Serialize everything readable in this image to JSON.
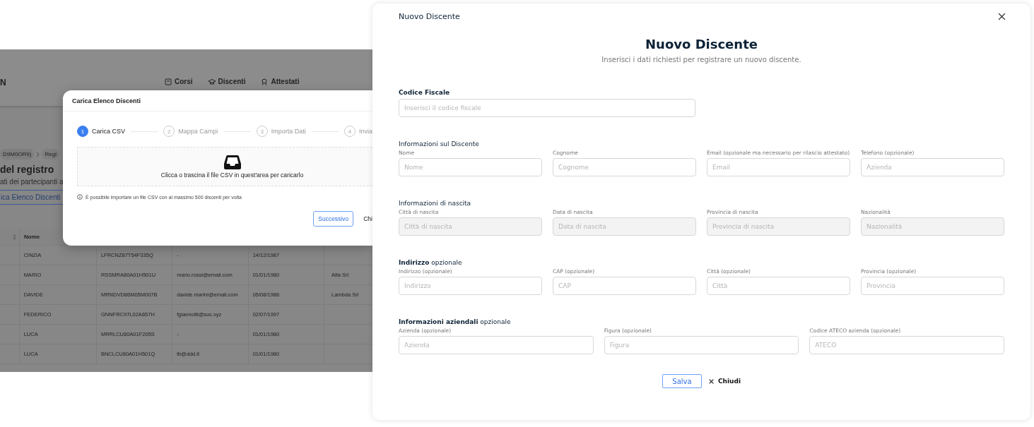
{
  "background_app": {
    "header": {
      "brand": "N",
      "nav": [
        {
          "label": "Corsi"
        },
        {
          "label": "Discenti"
        },
        {
          "label": "Attestati"
        }
      ]
    },
    "breadcrumb": [
      "D9M0OR9)",
      "Regi"
    ],
    "title": "del registro",
    "subtitle": "ati dei partecipanti a",
    "upload_button": "ica Elenco Discenti",
    "table": {
      "columns": [
        "Nome"
      ],
      "rows": [
        {
          "name": "CINZIA",
          "codice": "LFRCNZ87T54F335Q",
          "email": "-",
          "birth": "14/12/1987"
        },
        {
          "name": "MARIO",
          "codice": "RSSMRA80A01H501U",
          "email": "mario.rossi@email.com",
          "birth": "01/01/1980",
          "company": "Alfa Srl"
        },
        {
          "name": "DAVIDE",
          "codice": "MRNDVD86M05M007B",
          "email": "davide.marini@email.com",
          "birth": "05/08/1986",
          "company": "Lambda Srl"
        },
        {
          "name": "FEDERICO",
          "codice": "GNNFRC97L02A657H",
          "email": "fgiannotti@soc.xyz",
          "birth": "02/07/1997"
        },
        {
          "name": "LUCA",
          "codice": "MRRLCU80A01F205S",
          "email": "-",
          "birth": "01/01/1980"
        },
        {
          "name": "LUCA",
          "codice": "BNCLCU80A01H501Q",
          "email": "lb@ddd.it",
          "birth": "01/01/1980"
        }
      ]
    }
  },
  "upload_dialog": {
    "title": "Carica Elenco Discenti",
    "steps": [
      {
        "number": "1",
        "label": "Carica CSV",
        "selected": true
      },
      {
        "number": "2",
        "label": "Mappa Campi",
        "selected": false
      },
      {
        "number": "3",
        "label": "Importa Dati",
        "selected": false
      },
      {
        "number": "4",
        "label": "Invia",
        "selected": false
      }
    ],
    "dropzone_text": "Clicca o trascina il file CSV in quest'area per caricarlo",
    "info": "È possibile importare un file CSV con al massimo 500 discenti per volta",
    "buttons": [
      {
        "label": "Successivo",
        "kind": "primary"
      },
      {
        "label": "Chi",
        "kind": "text"
      }
    ]
  },
  "student_dialog": {
    "window_title": "Nuovo Discente",
    "heading": "Nuovo Discente",
    "subheading": "Inserisci i dati richiesti per registrare un nuovo discente.",
    "codice_fiscale": {
      "label": "Codice Fiscale",
      "placeholder": "Inserisci il codice fiscale"
    },
    "sections": [
      {
        "title": "Informazioni sul Discente",
        "fields": [
          {
            "label": "Nome",
            "placeholder": "Nome",
            "disabled": false
          },
          {
            "label": "Cognome",
            "placeholder": "Cognome",
            "disabled": false
          },
          {
            "label": "Email (opzionale ma necessario per rilascio attestato)",
            "placeholder": "Email",
            "disabled": false
          },
          {
            "label": "Telefono (opzionale)",
            "placeholder": "Azienda",
            "disabled": false
          }
        ]
      },
      {
        "title": "Informazioni di nascita",
        "fields": [
          {
            "label": "Città di nascita",
            "placeholder": "Città di nascita",
            "disabled": true
          },
          {
            "label": "Data di nascita",
            "placeholder": "Data di nascita",
            "disabled": true
          },
          {
            "label": "Provincia di nascita",
            "placeholder": "Provincia di nascita",
            "disabled": true
          },
          {
            "label": "Nazionalità",
            "placeholder": "Nazionalità",
            "disabled": true
          }
        ]
      },
      {
        "title": "**Indirizzo** opzionale",
        "fields": [
          {
            "label": "Indirizzo (opzionale)",
            "placeholder": "Indirizzo",
            "disabled": false
          },
          {
            "label": "CAP (opzionale)",
            "placeholder": "CAP",
            "disabled": false
          },
          {
            "label": "Città (opzionale)",
            "placeholder": "Città",
            "disabled": false
          },
          {
            "label": "Provincia (opzionale)",
            "placeholder": "Provincia",
            "disabled": false
          }
        ]
      },
      {
        "title": "**Informazioni aziendali** opzionale",
        "fields": [
          {
            "label": "Azienda (opzionale)",
            "placeholder": "Azienda",
            "disabled": false
          },
          {
            "label": "Figura (opzionale)",
            "placeholder": "Figura",
            "disabled": false
          },
          {
            "label": "Codice ATECO azienda (opzionale)",
            "placeholder": "ATECO",
            "disabled": false
          }
        ]
      }
    ],
    "save_button": "Salva",
    "close_button": "Chiudi"
  }
}
